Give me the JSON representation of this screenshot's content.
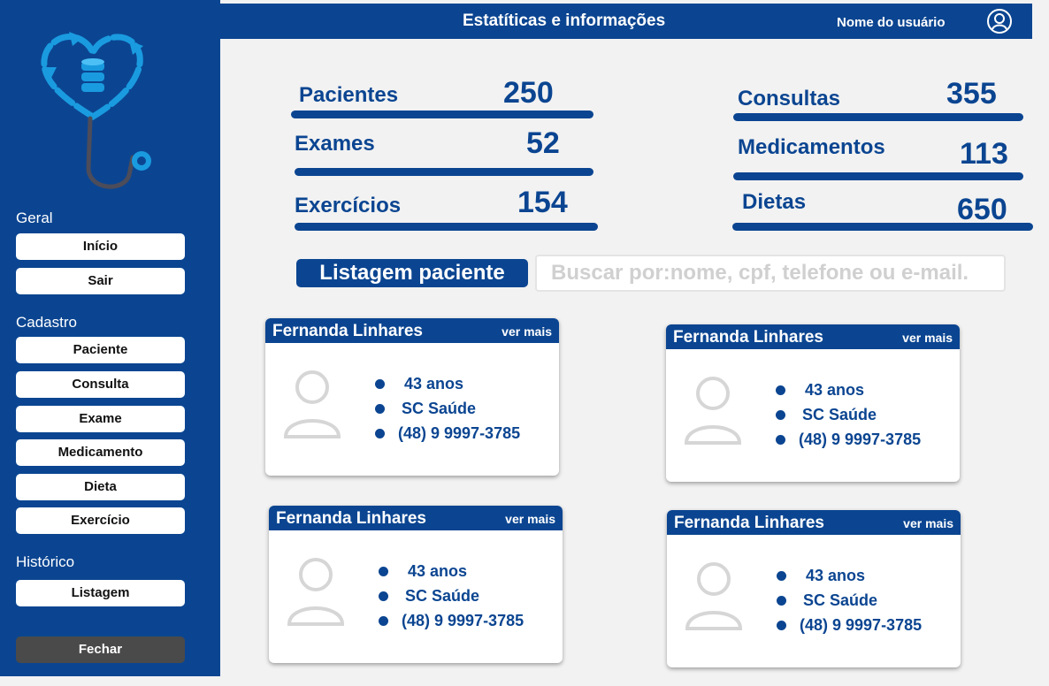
{
  "header": {
    "title": "Estatíticas e informações",
    "user_name": "Nome do usuário"
  },
  "sidebar": {
    "sections": [
      {
        "label": "Geral",
        "items": [
          "Início",
          "Sair"
        ]
      },
      {
        "label": "Cadastro",
        "items": [
          "Paciente",
          "Consulta",
          "Exame",
          "Medicamento",
          "Dieta",
          "Exercício"
        ]
      },
      {
        "label": "Histórico",
        "items": [
          "Listagem"
        ]
      }
    ],
    "close_label": "Fechar"
  },
  "stats": [
    {
      "label": "Pacientes",
      "value": "250"
    },
    {
      "label": "Exames",
      "value": "52"
    },
    {
      "label": "Exercícios",
      "value": "154"
    },
    {
      "label": "Consultas",
      "value": "355"
    },
    {
      "label": "Medicamentos",
      "value": "113"
    },
    {
      "label": "Dietas",
      "value": "650"
    }
  ],
  "listing": {
    "title": "Listagem paciente",
    "search_placeholder": "Buscar por:nome, cpf, telefone ou e-mail."
  },
  "patients": [
    {
      "name": "Fernanda Linhares",
      "more": "ver mais",
      "age": "43 anos",
      "plan": "SC Saúde",
      "phone": "(48) 9 9997-3785"
    },
    {
      "name": "Fernanda Linhares",
      "more": "ver mais",
      "age": "43 anos",
      "plan": "SC Saúde",
      "phone": "(48) 9 9997-3785"
    },
    {
      "name": "Fernanda Linhares",
      "more": "ver mais",
      "age": "43 anos",
      "plan": "SC Saúde",
      "phone": "(48) 9 9997-3785"
    },
    {
      "name": "Fernanda Linhares",
      "more": "ver mais",
      "age": "43 anos",
      "plan": "SC Saúde",
      "phone": "(48) 9 9997-3785"
    }
  ]
}
